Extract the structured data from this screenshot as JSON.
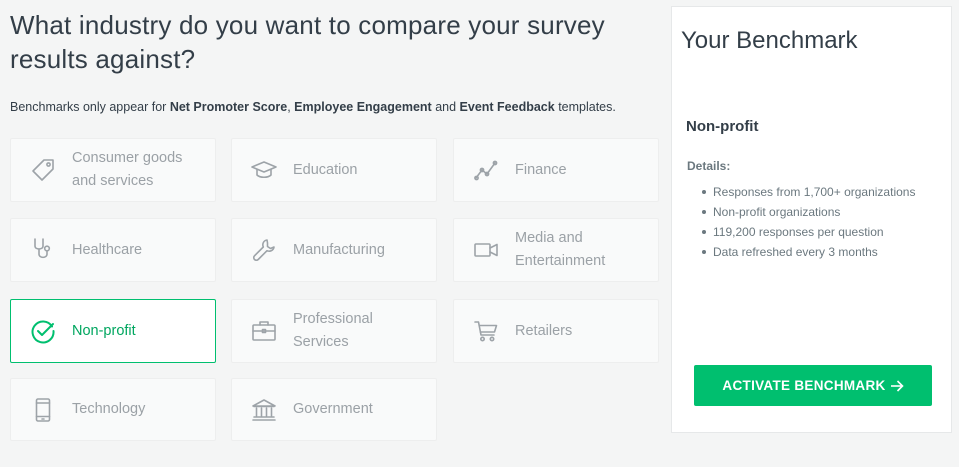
{
  "page": {
    "heading": "What industry do you want to compare your survey results against?",
    "note": {
      "prefix": "Benchmarks only appear for ",
      "item1": "Net Promoter Score",
      "sep1": ", ",
      "item2": "Employee Engagement",
      "sep2": " and ",
      "item3": "Event Feedback",
      "suffix": " templates."
    }
  },
  "industries": [
    {
      "label": "Consumer goods and services",
      "icon": "tag-icon",
      "selected": false
    },
    {
      "label": "Education",
      "icon": "graduation-cap-icon",
      "selected": false
    },
    {
      "label": "Finance",
      "icon": "trend-line-icon",
      "selected": false
    },
    {
      "label": "Healthcare",
      "icon": "stethoscope-icon",
      "selected": false
    },
    {
      "label": "Manufacturing",
      "icon": "wrench-icon",
      "selected": false
    },
    {
      "label": "Media and Entertainment",
      "icon": "video-camera-icon",
      "selected": false
    },
    {
      "label": "Non-profit",
      "icon": "check-circle-icon",
      "selected": true
    },
    {
      "label": "Professional Services",
      "icon": "briefcase-icon",
      "selected": false
    },
    {
      "label": "Retailers",
      "icon": "shopping-cart-icon",
      "selected": false
    },
    {
      "label": "Technology",
      "icon": "mobile-phone-icon",
      "selected": false
    },
    {
      "label": "Government",
      "icon": "government-building-icon",
      "selected": false
    }
  ],
  "benchmark": {
    "title": "Your Benchmark",
    "selected_industry": "Non-profit",
    "details_label": "Details:",
    "details": [
      "Responses from 1,700+ organizations",
      "Non-profit organizations",
      "119,200 responses per question",
      "Data refreshed every 3 months"
    ],
    "activate_label": "ACTIVATE BENCHMARK",
    "activate_icon": "arrow-right-icon"
  },
  "colors": {
    "accent": "#00bf6f",
    "text": "#333e48",
    "muted": "#9ba1a6",
    "background": "#f4f5f5"
  }
}
